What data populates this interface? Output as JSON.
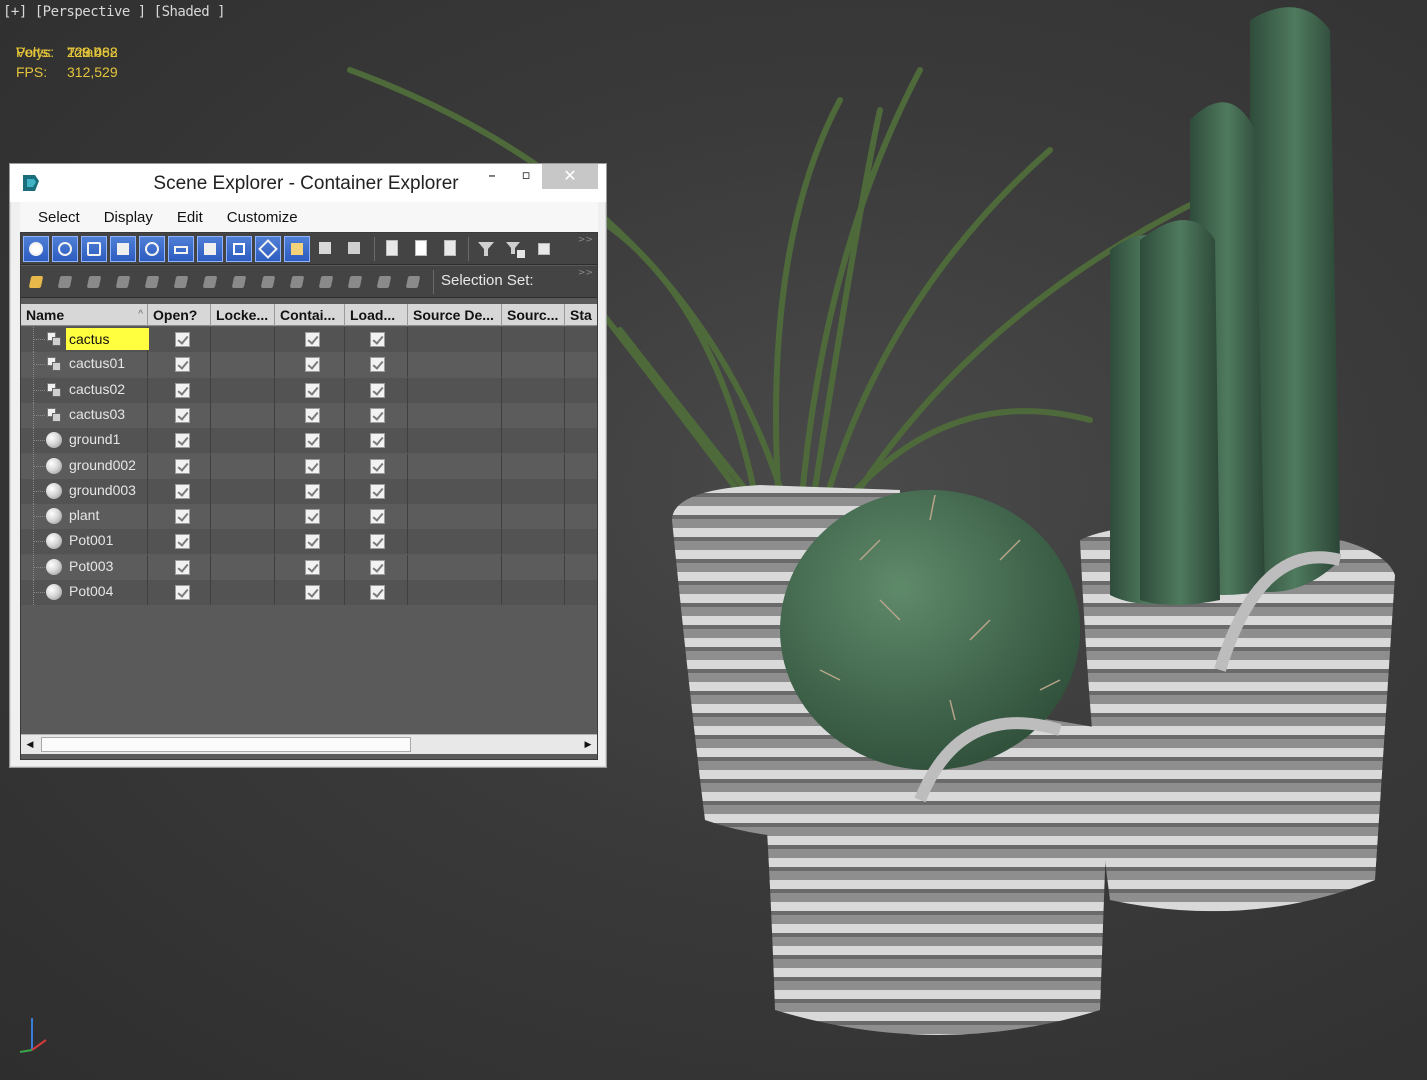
{
  "viewport": {
    "label": "[+] [Perspective ] [Shaded ]",
    "stats": {
      "header": "Total",
      "polys_label": "Polys:",
      "polys_value": "229 088",
      "verts_label": "Verts:",
      "verts_value": "223 462",
      "fps_label": "FPS:",
      "fps_value": "312,529"
    }
  },
  "window": {
    "title": "Scene Explorer - Container Explorer",
    "minimize": "–",
    "maximize": "▫",
    "close": "✕",
    "menu": [
      "Select",
      "Display",
      "Edit",
      "Customize"
    ],
    "selection_set_label": "Selection Set:",
    "columns": [
      "Name",
      "Open?",
      "Locke...",
      "Contai...",
      "Load...",
      "Source De...",
      "Sourc...",
      "Sta"
    ],
    "sort_indicator": "^",
    "rows": [
      {
        "name": "cactus",
        "type": "container",
        "selected": true
      },
      {
        "name": "cactus01",
        "type": "container",
        "selected": false
      },
      {
        "name": "cactus02",
        "type": "container",
        "selected": false
      },
      {
        "name": "cactus03",
        "type": "container",
        "selected": false
      },
      {
        "name": "ground1",
        "type": "geometry",
        "selected": false
      },
      {
        "name": "ground002",
        "type": "geometry",
        "selected": false
      },
      {
        "name": "ground003",
        "type": "geometry",
        "selected": false
      },
      {
        "name": "plant",
        "type": "geometry",
        "selected": false
      },
      {
        "name": "Pot001",
        "type": "geometry",
        "selected": false
      },
      {
        "name": "Pot003",
        "type": "geometry",
        "selected": false
      },
      {
        "name": "Pot004",
        "type": "geometry",
        "selected": false
      }
    ],
    "scroll_left": "◀",
    "scroll_right": "▶"
  },
  "colors": {
    "selection_highlight": "#ffff40",
    "stats_text": "#e5c53a",
    "toolbar_active": "#3f6fd0"
  }
}
